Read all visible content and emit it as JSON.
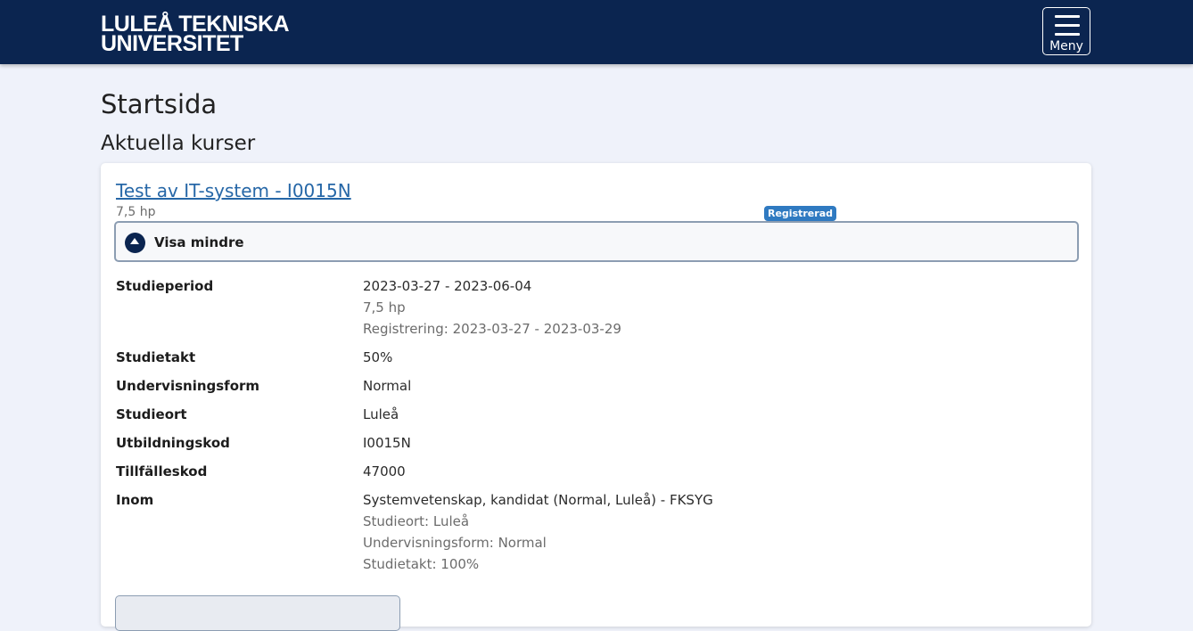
{
  "header": {
    "logo_line1": "LULEÅ TEKNISKA",
    "logo_line2": "UNIVERSITET",
    "menu_label": "Meny"
  },
  "page": {
    "title": "Startsida",
    "section_title": "Aktuella kurser"
  },
  "course": {
    "title": "Test av IT-system - I0015N",
    "credits": "7,5 hp",
    "badge": "Registrerad",
    "toggle_label": "Visa mindre",
    "details": [
      {
        "label": "Studieperiod",
        "value": "2023-03-27 - 2023-06-04",
        "sub": [
          "7,5 hp",
          "Registrering: 2023-03-27 - 2023-03-29"
        ]
      },
      {
        "label": "Studietakt",
        "value": "50%",
        "sub": []
      },
      {
        "label": "Undervisningsform",
        "value": "Normal",
        "sub": []
      },
      {
        "label": "Studieort",
        "value": "Luleå",
        "sub": []
      },
      {
        "label": "Utbildningskod",
        "value": "I0015N",
        "sub": []
      },
      {
        "label": "Tillfälleskod",
        "value": "47000",
        "sub": []
      },
      {
        "label": "Inom",
        "value": "Systemvetenskap, kandidat (Normal, Luleå) - FKSYG",
        "sub": [
          "Studieort: Luleå",
          "Undervisningsform: Normal",
          "Studietakt: 100%"
        ]
      }
    ]
  },
  "colors": {
    "header_bg": "#0b2550",
    "link": "#2667a7",
    "badge_bg": "#2f7ac1",
    "page_bg": "#eff2fa"
  }
}
